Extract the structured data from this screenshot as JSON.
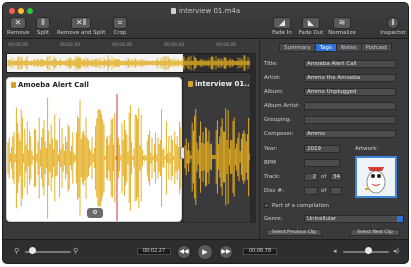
{
  "window": {
    "title": "interview 01.m4a"
  },
  "toolbar": {
    "left": [
      {
        "label": "Remove",
        "icon": "x-icon",
        "glyph": "✕"
      },
      {
        "label": "Split",
        "icon": "split-icon",
        "glyph": "⦀"
      },
      {
        "label": "Remove and Split",
        "icon": "remove-split-icon",
        "glyph": "✕⦀"
      },
      {
        "label": "Crop",
        "icon": "crop-icon",
        "glyph": "⌗"
      }
    ],
    "right": [
      {
        "label": "Fade In",
        "icon": "fade-in-icon",
        "glyph": "◢"
      },
      {
        "label": "Fade Out",
        "icon": "fade-out-icon",
        "glyph": "◣"
      },
      {
        "label": "Normalize",
        "icon": "normalize-icon",
        "glyph": "≋"
      },
      {
        "label": "Inspector",
        "icon": "info-icon",
        "glyph": "i"
      }
    ]
  },
  "timeline": {
    "ticks": [
      "00:00.00",
      "00:02.00",
      "00:04.00",
      "00:06.00",
      "00:08.00"
    ]
  },
  "clips": [
    {
      "title": "Amoeba Alert Call"
    },
    {
      "title": "interview 01...."
    }
  ],
  "inspector": {
    "tabs": [
      "Summary",
      "Tags",
      "Notes",
      "Podcast"
    ],
    "active_tab": "Tags",
    "fields": [
      {
        "label": "Title:",
        "value": "Amoeba Alert Call"
      },
      {
        "label": "Artist:",
        "value": "Ammo the Amoeba"
      },
      {
        "label": "Album:",
        "value": "Ammo Unplugged"
      },
      {
        "label": "Album Artist:",
        "value": ""
      },
      {
        "label": "Grouping:",
        "value": ""
      },
      {
        "label": "Composer:",
        "value": "Ammo"
      }
    ],
    "year": {
      "label": "Year:",
      "value": "2019"
    },
    "bpm": {
      "label": "BPM",
      "value": ""
    },
    "track": {
      "label": "Track:",
      "value": "2",
      "of_label": "of",
      "total": "34"
    },
    "disc": {
      "label": "Disc #:",
      "value": "",
      "of_label": "of",
      "total": ""
    },
    "artwork_label": "Artwork:",
    "compilation_label": "Part of a compilation",
    "genre": {
      "label": "Genre:",
      "value": "Unicellular"
    },
    "prev_clip": "Select Previous Clip",
    "next_clip": "Select Next Clip"
  },
  "transport": {
    "current_time": "00:02.27",
    "total_time": "00:06.78",
    "zoom_level": 0.15,
    "volume_level": 0.55
  },
  "colors": {
    "waveform": "#e3ad1e",
    "playhead": "#d0302b",
    "accent": "#2f73d8"
  }
}
